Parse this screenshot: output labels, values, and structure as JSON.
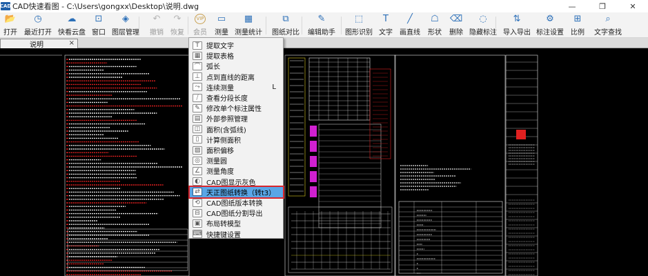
{
  "window": {
    "app_icon_text": "CAD",
    "title": "CAD快速看图 - C:\\Users\\gongxx\\Desktop\\说明.dwg",
    "minimize": "—",
    "restore": "❐",
    "close": "✕"
  },
  "toolbar": {
    "items": [
      {
        "label": "打开",
        "icon": "folder-open-icon",
        "glyph": "📂"
      },
      {
        "label": "最近打开",
        "icon": "recent-clock-icon",
        "glyph": "◷"
      },
      {
        "label": "快看云盘",
        "icon": "cloud-icon",
        "glyph": "☁"
      },
      {
        "label": "窗口",
        "icon": "window-icon",
        "glyph": "⊡"
      },
      {
        "label": "图层管理",
        "icon": "layers-icon",
        "glyph": "◈"
      },
      {
        "label": "撤销",
        "icon": "undo-icon",
        "glyph": "↶",
        "disabled": true
      },
      {
        "label": "恢复",
        "icon": "redo-icon",
        "glyph": "↷",
        "disabled": true
      },
      {
        "label": "会员",
        "icon": "vip-icon",
        "glyph": "VIP",
        "disabled": true
      },
      {
        "label": "测量",
        "icon": "measure-ruler-icon",
        "glyph": "▭"
      },
      {
        "label": "测量统计",
        "icon": "measure-stats-icon",
        "glyph": "▦"
      },
      {
        "label": "图纸对比",
        "icon": "compare-icon",
        "glyph": "⧉"
      },
      {
        "label": "编辑助手",
        "icon": "edit-assistant-icon",
        "glyph": "✎"
      },
      {
        "label": "图形识别",
        "icon": "shape-recognize-icon",
        "glyph": "⬚"
      },
      {
        "label": "文字",
        "icon": "text-icon",
        "glyph": "T"
      },
      {
        "label": "画直线",
        "icon": "line-icon",
        "glyph": "╱"
      },
      {
        "label": "形状",
        "icon": "shape-icon",
        "glyph": "☖"
      },
      {
        "label": "删除",
        "icon": "eraser-icon",
        "glyph": "⌫"
      },
      {
        "label": "隐藏标注",
        "icon": "hide-annotation-icon",
        "glyph": "◌"
      },
      {
        "label": "导入导出",
        "icon": "import-export-icon",
        "glyph": "⇅"
      },
      {
        "label": "标注设置",
        "icon": "annotation-settings-icon",
        "glyph": "⚙"
      },
      {
        "label": "比例",
        "icon": "scale-icon",
        "glyph": "⊞"
      },
      {
        "label": "文字查找",
        "icon": "text-search-icon",
        "glyph": "⌕"
      }
    ]
  },
  "tabs": [
    {
      "label": "说明",
      "close": "×"
    }
  ],
  "menu": {
    "items": [
      {
        "label": "提取文字",
        "icon": "extract-text-icon",
        "glyph": "T"
      },
      {
        "label": "提取表格",
        "icon": "extract-table-icon",
        "glyph": "▦"
      },
      {
        "label": "弧长",
        "icon": "arc-length-icon",
        "glyph": "⌒"
      },
      {
        "label": "点到直线的距离",
        "icon": "point-line-distance-icon",
        "glyph": "⊥"
      },
      {
        "label": "连续测量",
        "icon": "continuous-measure-icon",
        "glyph": "⤳",
        "shortcut": "L"
      },
      {
        "label": "查看分段长度",
        "icon": "segment-length-icon",
        "glyph": "⧸"
      },
      {
        "label": "修改单个标注属性",
        "icon": "annotation-property-icon",
        "glyph": "✎"
      },
      {
        "label": "外部参照管理",
        "icon": "xref-icon",
        "glyph": "▤"
      },
      {
        "label": "面积(含弧线)",
        "icon": "area-arc-icon",
        "glyph": "◫"
      },
      {
        "label": "计算侧面积",
        "icon": "side-area-icon",
        "glyph": "▯"
      },
      {
        "label": "面积偏移",
        "icon": "area-offset-icon",
        "glyph": "▨"
      },
      {
        "label": "测量圆",
        "icon": "measure-circle-icon",
        "glyph": "◎"
      },
      {
        "label": "测量角度",
        "icon": "measure-angle-icon",
        "glyph": "∠"
      },
      {
        "label": "CAD图显示灰色",
        "icon": "gray-display-icon",
        "glyph": "◐"
      },
      {
        "label": "天正图纸转换（转t3）",
        "icon": "tangent-convert-icon",
        "glyph": "⇄",
        "highlight": true
      },
      {
        "label": "CAD图纸版本转换",
        "icon": "version-convert-icon",
        "glyph": "⟲"
      },
      {
        "label": "CAD图纸分割导出",
        "icon": "split-export-icon",
        "glyph": "⊟"
      },
      {
        "label": "布局转模型",
        "icon": "layout-to-model-icon",
        "glyph": "▣"
      },
      {
        "label": "快捷键设置",
        "icon": "shortcut-settings-icon",
        "glyph": "⌨"
      }
    ]
  },
  "colors": {
    "canvas": "#000000",
    "drawing_red": "#e02020",
    "drawing_white": "#e8e8e8",
    "drawing_yellow": "#e0d020",
    "drawing_magenta": "#d020d0",
    "highlight": "#5aa6e6",
    "highlight_border": "#d9262c"
  }
}
